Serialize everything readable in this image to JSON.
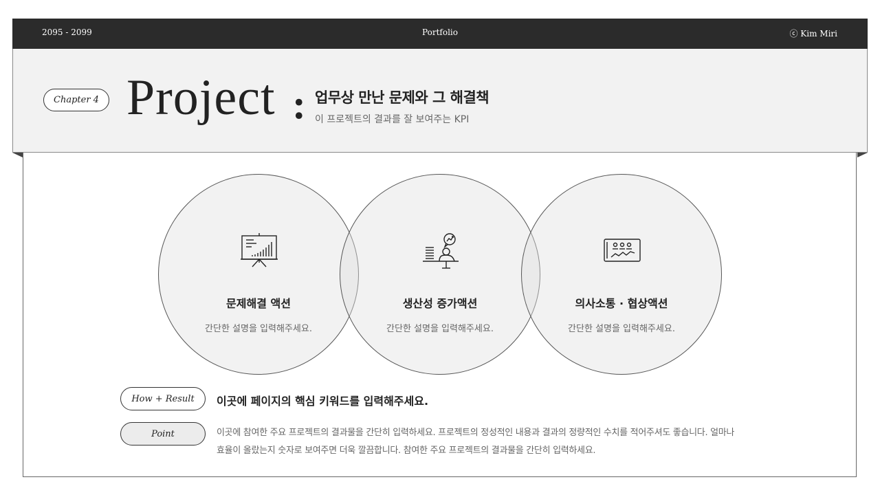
{
  "topbar": {
    "left": "2095 - 2099",
    "center": "Portfolio",
    "right": "ⓒ Kim Miri"
  },
  "header": {
    "chapter": "Chapter 4",
    "big_title": "Project",
    "colon": ":",
    "title": "업무상 만난 문제와 그 해결책",
    "subtitle": "이 프로젝트의 결과를 잘 보여주는 KPI"
  },
  "circles": [
    {
      "icon": "presentation-board-icon",
      "title": "문제해결 액션",
      "desc": "간단한 설명을 입력해주세요."
    },
    {
      "icon": "person-desk-chat-icon",
      "title": "생산성 증가액션",
      "desc": "간단한 설명을 입력해주세요."
    },
    {
      "icon": "team-chart-icon",
      "title": "의사소통 · 협상액션",
      "desc": "간단한 설명을 입력해주세요."
    }
  ],
  "how_result": {
    "label": "How + Result",
    "text": "이곳에 페이지의 핵심 키워드를 입력해주세요."
  },
  "point": {
    "label": "Point",
    "text": "이곳에 참여한 주요 프로젝트의 결과물을 간단히 입력하세요. 프로젝트의 정성적인 내용과 결과의 정량적인 수치를 적어주셔도 좋습니다. 얼마나 효율이 올랐는지 숫자로 보여주면 더욱 깔끔합니다. 참여한 주요 프로젝트의 결과물을 간단히 입력하세요."
  },
  "colors": {
    "topbar_bg": "#2b2b2b",
    "header_bg": "#f2f2f2",
    "circle_fill": "#e1e1e1"
  }
}
